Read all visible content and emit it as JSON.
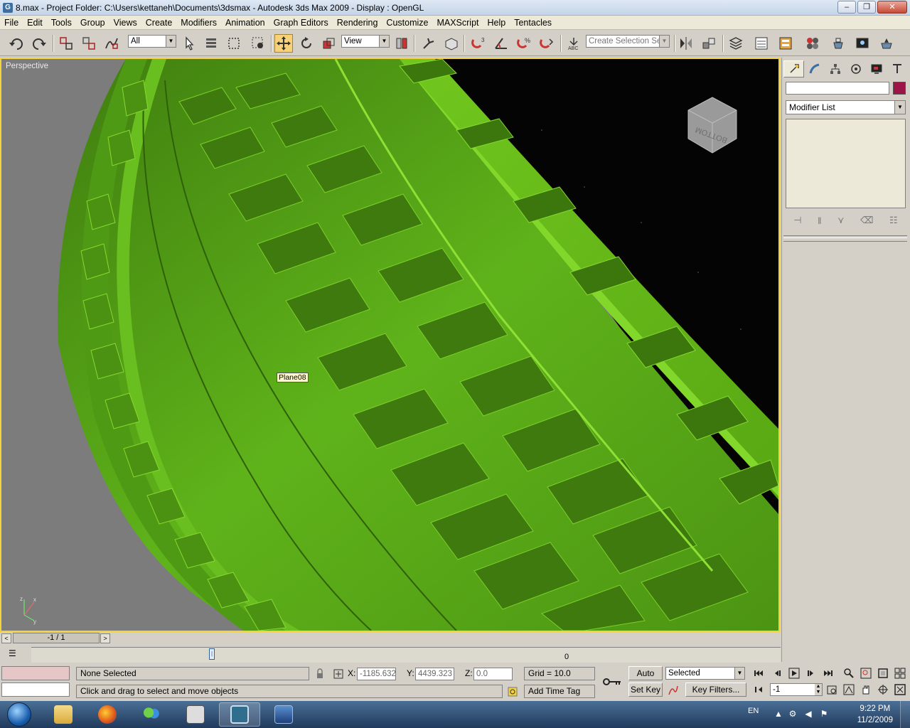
{
  "window": {
    "title": "8.max      - Project Folder: C:\\Users\\kettaneh\\Documents\\3dsmax      - Autodesk 3ds Max  2009        - Display : OpenGL",
    "minimize": "‒",
    "restore": "❐",
    "close": "✕"
  },
  "menu": [
    "File",
    "Edit",
    "Tools",
    "Group",
    "Views",
    "Create",
    "Modifiers",
    "Animation",
    "Graph Editors",
    "Rendering",
    "Customize",
    "MAXScript",
    "Help",
    "Tentacles"
  ],
  "toolbar": {
    "selection_filter": "All",
    "reference_coord": "View",
    "named_selection_placeholder": "Create Selection Set"
  },
  "viewport": {
    "label": "Perspective",
    "object_tooltip": "Plane08",
    "viewcube_label": "BOTTOM",
    "mesh_color": "#5fb31a",
    "background_color": "#7c7c7c"
  },
  "command_panel": {
    "modifier_list": "Modifier List",
    "object_color": "#9d1446"
  },
  "time_slider": {
    "frame": "-1 / 1",
    "prev": "<",
    "next": ">",
    "current_frame_marker": "0"
  },
  "status": {
    "selection": "None Selected",
    "prompt": "Click and drag to select and move objects",
    "x_label": "X:",
    "x_value": "-1185.632",
    "y_label": "Y:",
    "y_value": "4439.323",
    "z_label": "Z:",
    "z_value": "0.0",
    "grid": "Grid = 10.0",
    "add_time_tag": "Add Time Tag",
    "auto_key": "Auto Key",
    "set_key": "Set Key",
    "key_mode": "Selected",
    "key_filters": "Key Filters...",
    "current_frame": "-1"
  },
  "taskbar": {
    "lang": "EN",
    "time": "9:22 PM",
    "date": "11/2/2009"
  }
}
